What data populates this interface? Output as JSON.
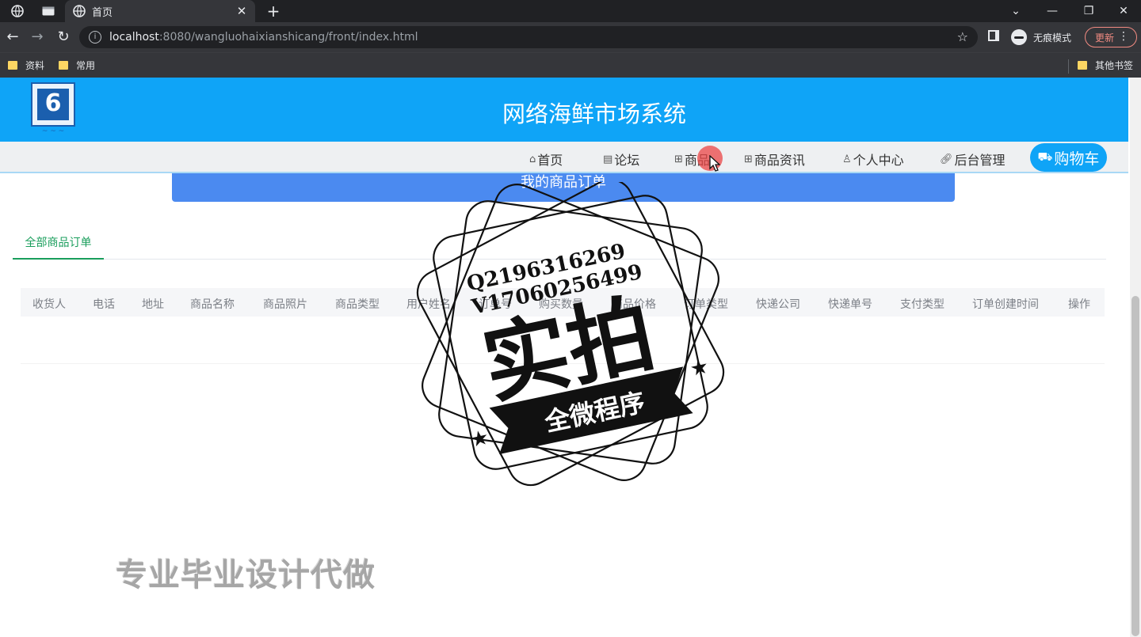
{
  "browser": {
    "tab_title": "首页",
    "new_tab": "+",
    "url_host": "localhost",
    "url_rest": ":8080/wangluohaixianshicang/front/index.html",
    "incognito_label": "无痕模式",
    "update_label": "更新",
    "bookmarks": [
      "资料",
      "常用"
    ],
    "other_bookmarks": "其他书签"
  },
  "site": {
    "title": "网络海鲜市场系统",
    "logo_glyph": "6",
    "logo_signature": "~ ~ ~"
  },
  "nav": {
    "home": "首页",
    "forum": "论坛",
    "goods": "商品",
    "news": "商品资讯",
    "profile": "个人中心",
    "admin": "后台管理",
    "cart": "购物车"
  },
  "orders": {
    "banner": "我的商品订单",
    "tab_all": "全部商品订单",
    "columns": [
      "收货人",
      "电话",
      "地址",
      "商品名称",
      "商品照片",
      "商品类型",
      "用户姓名",
      "订单号",
      "购买数量",
      "商品价格",
      "订单类型",
      "快递公司",
      "快递单号",
      "支付类型",
      "订单创建时间",
      "操作"
    ]
  },
  "watermark": {
    "line1": "Q2196316269",
    "line2": "V17060256499",
    "big": "实拍",
    "ribbon": "全微程序",
    "bottom": "专业毕业设计代做"
  }
}
